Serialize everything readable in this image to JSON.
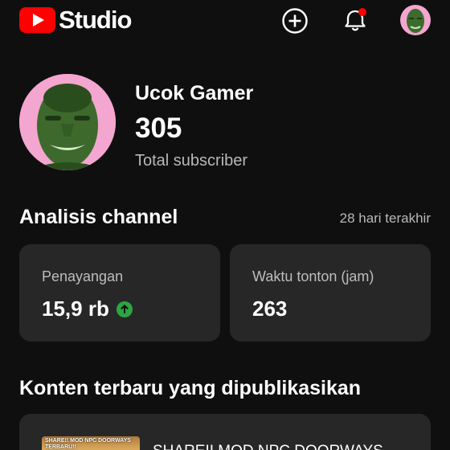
{
  "header": {
    "logo_text": "Studio",
    "icons": [
      "create-icon",
      "notifications-icon",
      "account-avatar"
    ],
    "notification_dot_color": "#ff0000"
  },
  "channel": {
    "name": "Ucok Gamer",
    "subscriber_count": "305",
    "subscriber_label": "Total subscriber"
  },
  "analytics": {
    "title": "Analisis channel",
    "period": "28 hari terakhir",
    "cards": [
      {
        "label": "Penayangan",
        "value": "15,9 rb",
        "trend": "up"
      },
      {
        "label": "Waktu tonton (jam)",
        "value": "263"
      }
    ],
    "trend_color": "#2ba640"
  },
  "recent": {
    "title": "Konten terbaru yang dipublikasikan",
    "video_title": "SHAREII MOD NPC DOORWAYS",
    "thumbnail_text": "SHARE!! MOD NPC DOORWAYS TERBARU!!"
  },
  "colors": {
    "background": "#0f0f0f",
    "card": "#272727",
    "brand": "#ff0000"
  }
}
